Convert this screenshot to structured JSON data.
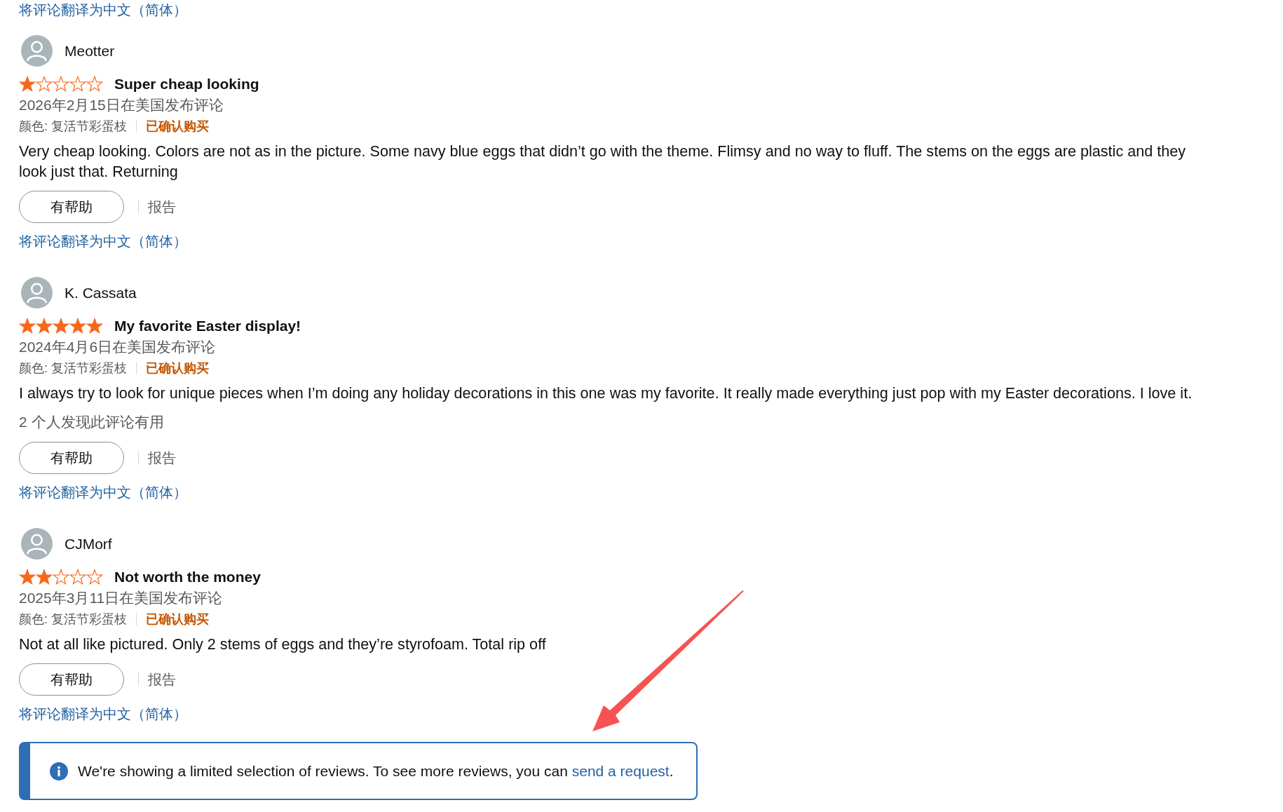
{
  "previous_review": {
    "translate_link": "将评论翻译为中文（简体）"
  },
  "reviews": [
    {
      "author": "Meotter",
      "stars": 1,
      "title": "Super cheap looking",
      "date": "2026年2月15日在美国发布评论",
      "variant": "颜色: 复活节彩蛋枝",
      "verified": "已确认购买",
      "body": "Very cheap looking. Colors are not as in the picture. Some navy blue eggs that didn’t go with the theme. Flimsy and no way to fluff. The stems on the eggs are plastic and they look just that. Returning",
      "helpful_button": "有帮助",
      "report_link": "报告",
      "translate_link": "将评论翻译为中文（简体）"
    },
    {
      "author": "K. Cassata",
      "stars": 5,
      "title": "My favorite Easter display!",
      "date": "2024年4月6日在美国发布评论",
      "variant": "颜色: 复活节彩蛋枝",
      "verified": "已确认购买",
      "body": "I always try to look for unique pieces when I’m doing any holiday decorations in this one was my favorite. It really made everything just pop with my Easter decorations. I love it.",
      "helpful_count": "2 个人发现此评论有用",
      "helpful_button": "有帮助",
      "report_link": "报告",
      "translate_link": "将评论翻译为中文（简体）"
    },
    {
      "author": "CJMorf",
      "stars": 2,
      "title": "Not worth the money",
      "date": "2025年3月11日在美国发布评论",
      "variant": "颜色: 复活节彩蛋枝",
      "verified": "已确认购买",
      "body": "Not at all like pictured. Only 2 stems of eggs and they’re styrofoam. Total rip off",
      "helpful_button": "有帮助",
      "report_link": "报告",
      "translate_link": "将评论翻译为中文（简体）"
    }
  ],
  "notice": {
    "text_before": "We're showing a limited selection of reviews. To see more reviews, you can ",
    "link": "send a request",
    "text_after": "."
  }
}
